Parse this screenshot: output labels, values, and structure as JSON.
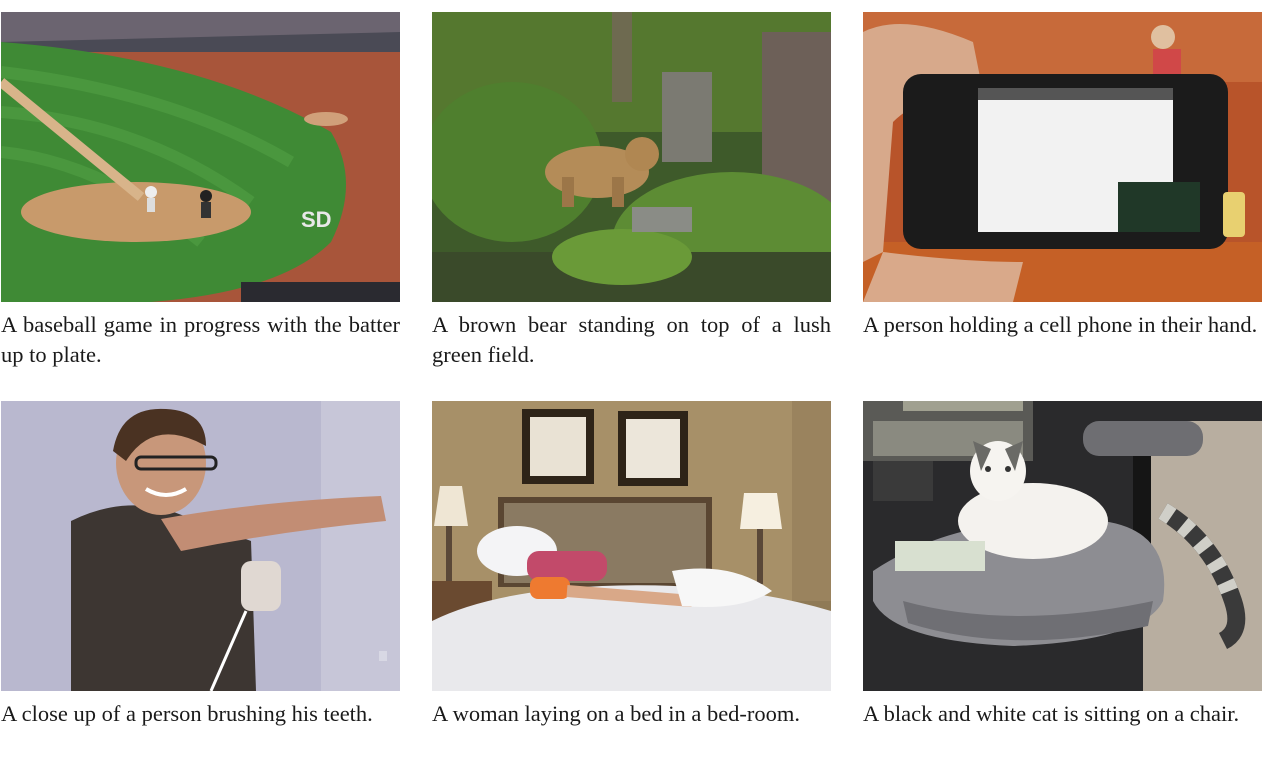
{
  "figure": {
    "items": [
      {
        "caption": "A baseball game in progress with the batter up to plate."
      },
      {
        "caption": "A brown bear standing on top of a lush green field."
      },
      {
        "caption": "A person holding a cell phone in their hand."
      },
      {
        "caption": "A close up of a person brushing his teeth."
      },
      {
        "caption": "A woman laying on a bed in a bed-room."
      },
      {
        "caption": "A black and white cat is sitting on a chair."
      }
    ]
  }
}
